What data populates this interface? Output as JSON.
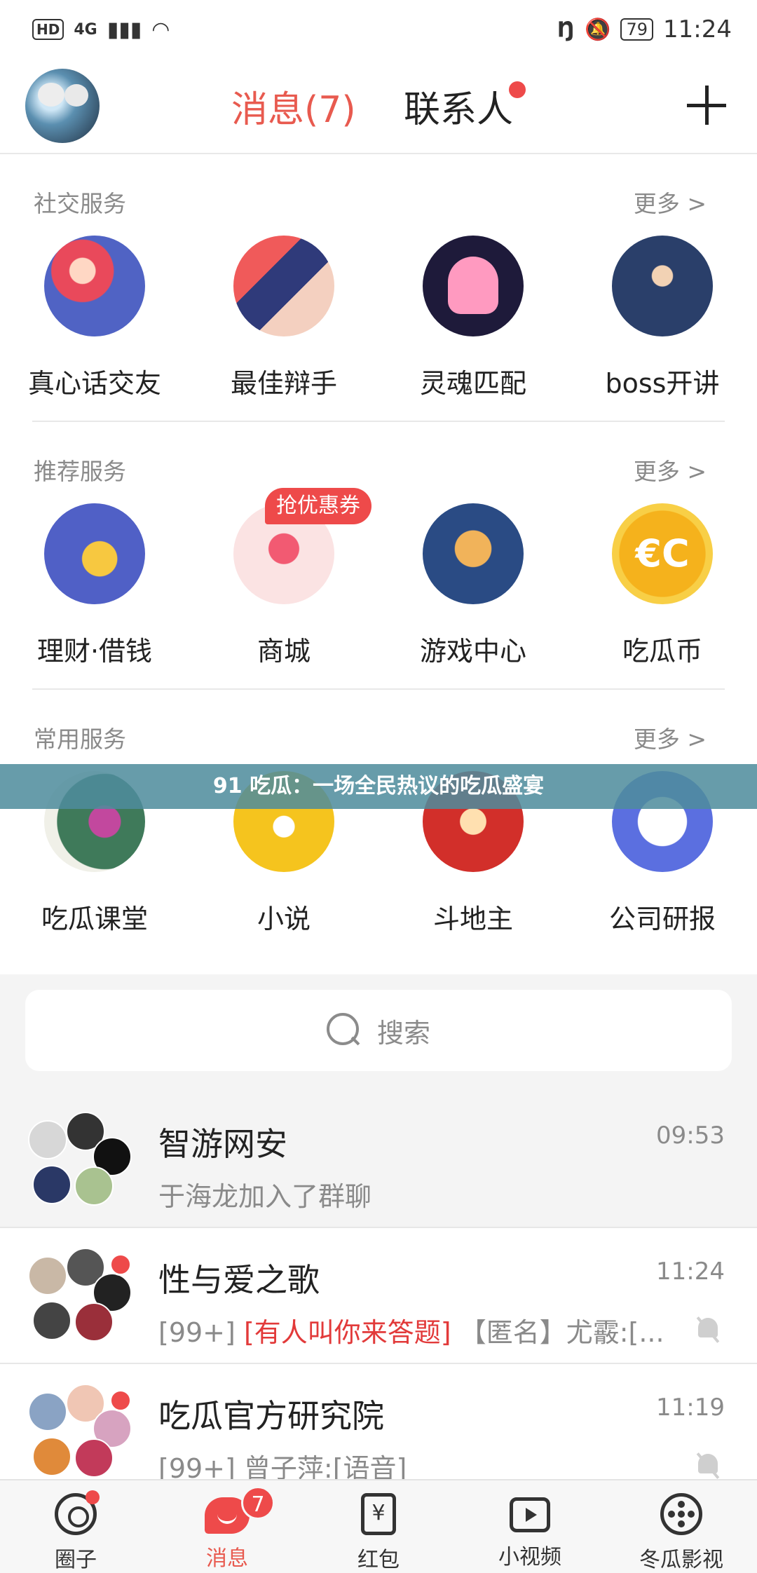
{
  "status_bar": {
    "hd": "HD",
    "network": "4G",
    "battery": "79",
    "time": "11:24"
  },
  "header": {
    "tab_messages": "消息(7)",
    "tab_contacts": "联系人"
  },
  "sections": {
    "social": {
      "title": "社交服务",
      "more": "更多 >",
      "items": [
        "真心话交友",
        "最佳辩手",
        "灵魂匹配",
        "boss开讲"
      ]
    },
    "recommended": {
      "title": "推荐服务",
      "more": "更多 >",
      "coupon": "抢优惠券",
      "items": [
        "理财·借钱",
        "商城",
        "游戏中心",
        "吃瓜币"
      ],
      "coin_glyph": "€C"
    },
    "common": {
      "title": "常用服务",
      "more": "更多 >",
      "items": [
        "吃瓜课堂",
        "小说",
        "斗地主",
        "公司研报"
      ]
    }
  },
  "banner": "91 吃瓜：一场全民热议的吃瓜盛宴",
  "search": {
    "placeholder": "搜索"
  },
  "chats": [
    {
      "name": "智游网安",
      "time": "09:53",
      "preview": "于海龙加入了群聊"
    },
    {
      "name": "性与爱之歌",
      "time": "11:24",
      "count": "[99+]",
      "highlight": "[有人叫你来答题]",
      "preview_rest": "【匿名】尤霰:[..."
    },
    {
      "name": "吃瓜官方研究院",
      "time": "11:19",
      "preview": "[99+] 曾子萍:[语音]"
    }
  ],
  "bottom_nav": {
    "items": [
      "圈子",
      "消息",
      "红包",
      "小视频",
      "冬瓜影视"
    ],
    "message_badge": "7"
  },
  "colors": {
    "accent": "#e85a4f",
    "badge": "#ee4a4a",
    "banner": "#4e8c9c"
  }
}
